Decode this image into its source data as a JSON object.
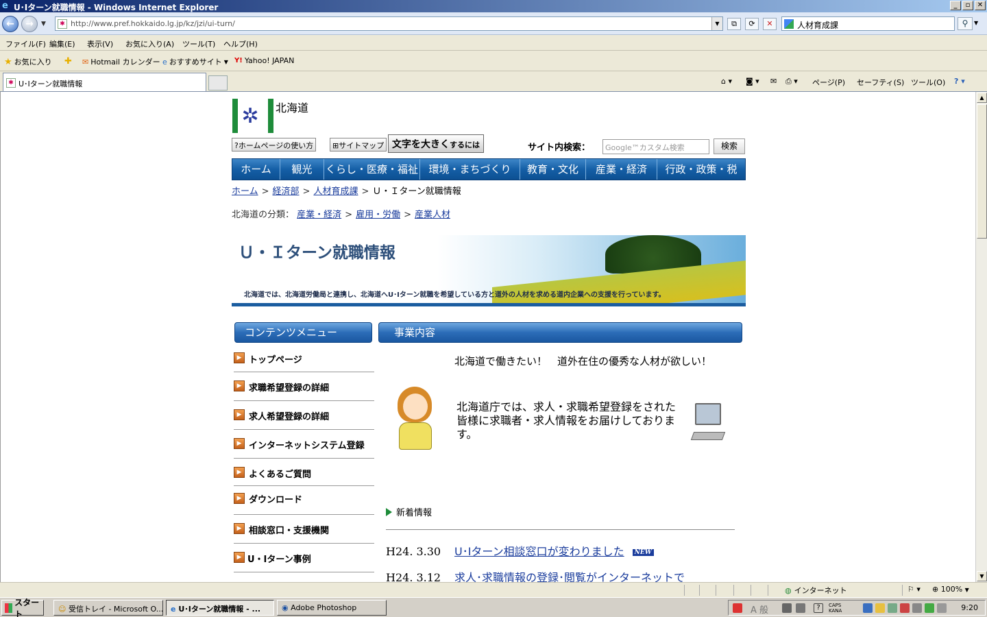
{
  "window": {
    "title": "U･Iターン就職情報 - Windows Internet Explorer"
  },
  "address": {
    "url": "http://www.pref.hokkaido.lg.jp/kz/jzi/ui-turn/",
    "search_value": "人材育成課"
  },
  "menubar": [
    "ファイル(F)",
    "編集(E)",
    "表示(V)",
    "お気に入り(A)",
    "ツール(T)",
    "ヘルプ(H)"
  ],
  "favorites": {
    "label": "お気に入り",
    "items": [
      "Hotmail カレンダー",
      "おすすめサイト",
      "Yahoo! JAPAN"
    ]
  },
  "tab": {
    "title": "U･Iターン就職情報"
  },
  "commandbar": [
    "ページ(P)",
    "セーフティ(S)",
    "ツール(O)"
  ],
  "site": {
    "logo_text": "北海道",
    "util_howto": "?ホームページの使い方",
    "util_sitemap": "サイトマップ",
    "big_text_main": "文字を大きく",
    "big_text_small": "するには",
    "search_label": "サイト内検索：",
    "search_placeholder": "Google™カスタム検索",
    "search_button": "検索",
    "global_nav": [
      "ホーム",
      "観光",
      "くらし・医療・福祉",
      "環境・まちづくり",
      "教育・文化",
      "産業・経済",
      "行政・政策・税"
    ],
    "breadcrumb": [
      "ホーム",
      "経済部",
      "人材育成課"
    ],
    "breadcrumb_current": "Ｕ・Ｉターン就職情報",
    "category_label": "北海道の分類：",
    "categories": [
      "産業・経済",
      "雇用・労働",
      "産業人材"
    ],
    "banner_title": "Ｕ・Ｉターン就職情報",
    "banner_desc": "北海道では、北海道労働局と連携し、北海道へU･Iターン就職を希望している方と道外の人材を求める道内企業への支援を行っています。",
    "menu_head": "コンテンツメニュー",
    "content_head": "事業内容",
    "menu_items": [
      "トップページ",
      "求職希望登録の詳細",
      "求人希望登録の詳細",
      "インターネットシステム登録",
      "よくあるご質問",
      "ダウンロード",
      "相談窓口・支援機関",
      "U・Iターン事例"
    ],
    "heading": "北海道で働きたい！　道外在住の優秀な人材が欲しい！",
    "intro": "北海道庁では、求人・求職希望登録をされた皆様に求職者・求人情報をお届けしております。",
    "news_title": "新着情報",
    "news": [
      {
        "date": "H24. 3.30",
        "text": "U･Iターン相談窓口が変わりました",
        "badge": "NEW"
      },
      {
        "date": "H24. 3.12",
        "text": "求人･求職情報の登録･閲覧がインターネットで"
      }
    ]
  },
  "statusbar": {
    "zone": "インターネット",
    "zoom": "100%"
  },
  "taskbar": {
    "start": "スタート",
    "tasks": [
      "受信トレイ - Microsoft O...",
      "U･Iターン就職情報 - ...",
      "Adobe Photoshop"
    ],
    "ime": "A 般",
    "clock": "9:20"
  }
}
